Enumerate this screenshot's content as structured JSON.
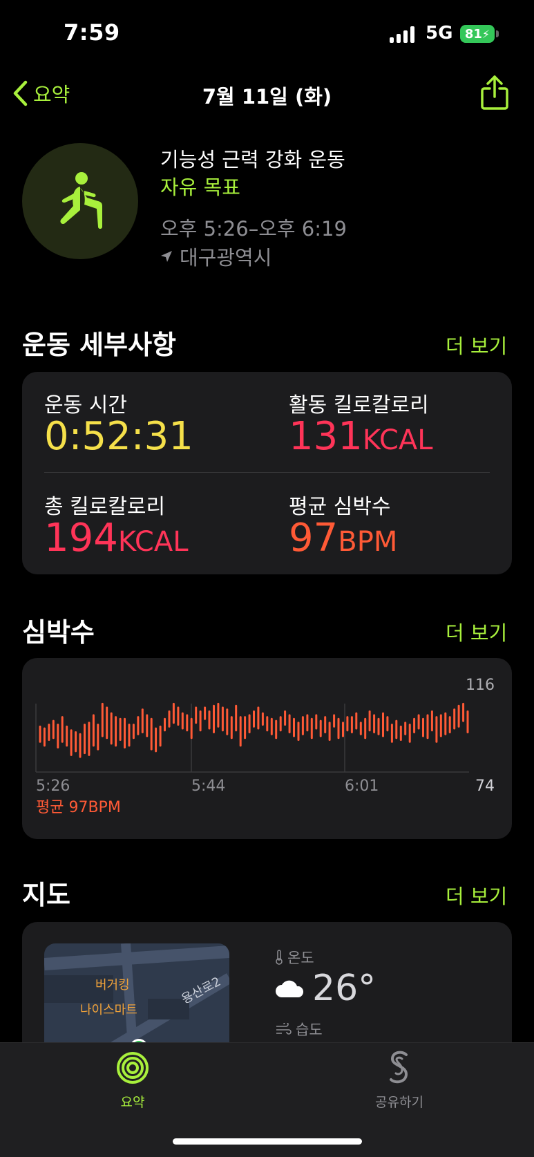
{
  "status_bar": {
    "time": "7:59",
    "network": "5G",
    "battery": "81"
  },
  "nav": {
    "back_label": "요약",
    "title": "7월 11일 (화)"
  },
  "workout": {
    "title": "기능성 근력 강화 운동",
    "goal": "자유 목표",
    "time_range": "오후 5:26–오후 6:19",
    "location": "대구광역시",
    "icon": "strength-training-icon"
  },
  "details": {
    "title": "운동 세부사항",
    "more": "더 보기",
    "metrics": [
      {
        "label": "운동 시간",
        "value": "0:52:31",
        "unit": ""
      },
      {
        "label": "활동 킬로칼로리",
        "value": "131",
        "unit": "KCAL"
      },
      {
        "label": "총 킬로칼로리",
        "value": "194",
        "unit": "KCAL"
      },
      {
        "label": "평균 심박수",
        "value": "97",
        "unit": "BPM"
      }
    ]
  },
  "heart_rate": {
    "title": "심박수",
    "more": "더 보기",
    "average_label": "평균 97BPM",
    "colors": {
      "bars": "#ff5a36",
      "grid": "#3a3a3c"
    }
  },
  "chart_data": {
    "type": "bar",
    "subtype": "range",
    "x_ticks": [
      "5:26",
      "5:44",
      "6:01"
    ],
    "y_max_label": "116",
    "y_min_label": "74",
    "ylim": [
      74,
      116
    ],
    "series": [
      {
        "values": [
          [
            90,
            98
          ],
          [
            88,
            97
          ],
          [
            91,
            99
          ],
          [
            92,
            101
          ],
          [
            87,
            99
          ],
          [
            90,
            103
          ],
          [
            88,
            98
          ],
          [
            83,
            96
          ],
          [
            85,
            95
          ],
          [
            82,
            94
          ],
          [
            84,
            99
          ],
          [
            83,
            100
          ],
          [
            88,
            104
          ],
          [
            86,
            99
          ],
          [
            93,
            110
          ],
          [
            92,
            108
          ],
          [
            89,
            105
          ],
          [
            88,
            103
          ],
          [
            91,
            102
          ],
          [
            87,
            102
          ],
          [
            88,
            99
          ],
          [
            92,
            99
          ],
          [
            94,
            103
          ],
          [
            95,
            107
          ],
          [
            93,
            104
          ],
          [
            86,
            102
          ],
          [
            85,
            97
          ],
          [
            88,
            98
          ],
          [
            96,
            102
          ],
          [
            98,
            106
          ],
          [
            100,
            110
          ],
          [
            99,
            108
          ],
          [
            97,
            105
          ],
          [
            96,
            104
          ],
          [
            92,
            102
          ],
          [
            100,
            108
          ],
          [
            96,
            106
          ],
          [
            102,
            108
          ],
          [
            97,
            106
          ],
          [
            95,
            109
          ],
          [
            98,
            110
          ],
          [
            96,
            108
          ],
          [
            94,
            107
          ],
          [
            92,
            103
          ],
          [
            96,
            109
          ],
          [
            88,
            103
          ],
          [
            92,
            103
          ],
          [
            95,
            104
          ],
          [
            98,
            106
          ],
          [
            97,
            108
          ],
          [
            99,
            105
          ],
          [
            96,
            103
          ],
          [
            94,
            102
          ],
          [
            92,
            101
          ],
          [
            96,
            103
          ],
          [
            99,
            106
          ],
          [
            95,
            104
          ],
          [
            93,
            102
          ],
          [
            91,
            100
          ],
          [
            94,
            103
          ],
          [
            96,
            104
          ],
          [
            92,
            102
          ],
          [
            97,
            104
          ],
          [
            93,
            101
          ],
          [
            95,
            103
          ],
          [
            91,
            100
          ],
          [
            98,
            104
          ],
          [
            92,
            102
          ],
          [
            93,
            100
          ],
          [
            96,
            103
          ],
          [
            95,
            103
          ],
          [
            97,
            105
          ],
          [
            94,
            100
          ],
          [
            92,
            102
          ],
          [
            96,
            106
          ],
          [
            95,
            104
          ],
          [
            94,
            102
          ],
          [
            93,
            105
          ],
          [
            96,
            103
          ],
          [
            90,
            99
          ],
          [
            92,
            101
          ],
          [
            91,
            98
          ],
          [
            94,
            100
          ],
          [
            90,
            99
          ],
          [
            95,
            102
          ],
          [
            97,
            104
          ],
          [
            93,
            102
          ],
          [
            92,
            104
          ],
          [
            96,
            106
          ],
          [
            90,
            103
          ],
          [
            93,
            104
          ],
          [
            94,
            105
          ],
          [
            95,
            103
          ],
          [
            97,
            107
          ],
          [
            98,
            109
          ],
          [
            101,
            110
          ],
          [
            95,
            106
          ]
        ]
      }
    ],
    "grid": true
  },
  "map_section": {
    "title": "지도",
    "more": "더 보기",
    "map_pois": [
      "버거킹",
      "나이스마트",
      "용산로2"
    ],
    "temperature_label": "온도",
    "temperature": "26°",
    "humidity_label": "습도"
  },
  "tabbar": {
    "summary": "요약",
    "sharing": "공유하기"
  }
}
